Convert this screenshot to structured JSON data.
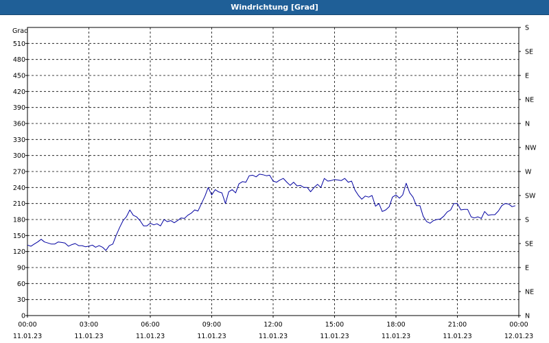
{
  "window": {
    "title": "Windrichtung [Grad]"
  },
  "chart_data": {
    "type": "line",
    "title": "Windrichtung [Grad]",
    "ylabel": "Grad",
    "ylim": [
      0,
      540
    ],
    "yticks": [
      0,
      30,
      60,
      90,
      120,
      150,
      180,
      210,
      240,
      270,
      300,
      330,
      360,
      390,
      420,
      450,
      480,
      510
    ],
    "right_axis_labels": [
      "N",
      "NE",
      "E",
      "SE",
      "S",
      "SW",
      "W",
      "NW",
      "N",
      "NE",
      "E",
      "SE",
      "S"
    ],
    "right_axis_values": [
      0,
      45,
      90,
      135,
      180,
      225,
      270,
      315,
      360,
      405,
      450,
      495,
      540
    ],
    "xlim": [
      0,
      24
    ],
    "xticks": [
      {
        "hours": 0,
        "time": "00:00",
        "date": "11.01.23"
      },
      {
        "hours": 3,
        "time": "03:00",
        "date": "11.01.23"
      },
      {
        "hours": 6,
        "time": "06:00",
        "date": "11.01.23"
      },
      {
        "hours": 9,
        "time": "09:00",
        "date": "11.01.23"
      },
      {
        "hours": 12,
        "time": "12:00",
        "date": "11.01.23"
      },
      {
        "hours": 15,
        "time": "15:00",
        "date": "11.01.23"
      },
      {
        "hours": 18,
        "time": "18:00",
        "date": "11.01.23"
      },
      {
        "hours": 21,
        "time": "21:00",
        "date": "11.01.23"
      },
      {
        "hours": 24,
        "time": "00:00",
        "date": "12.01.23"
      }
    ],
    "grid": true,
    "line_color": "#0000a0",
    "series": [
      {
        "x": [
          0,
          0.17,
          0.33,
          0.5,
          0.67,
          0.83,
          1.0,
          1.17,
          1.33,
          1.5,
          1.67,
          1.83,
          2.0,
          2.17,
          2.33,
          2.5,
          2.67,
          2.83,
          3.0,
          3.17,
          3.33,
          3.5,
          3.67,
          3.83,
          4.0,
          4.17,
          4.33,
          4.5,
          4.67,
          4.83,
          5.0,
          5.17,
          5.33,
          5.5,
          5.67,
          5.83,
          6.0,
          6.17,
          6.33,
          6.5,
          6.67,
          6.83,
          7.0,
          7.17,
          7.33,
          7.5,
          7.67,
          7.83,
          8.0,
          8.17,
          8.33,
          8.5,
          8.67,
          8.83,
          9.0,
          9.17,
          9.33,
          9.5,
          9.67,
          9.83,
          10.0,
          10.17,
          10.33,
          10.5,
          10.67,
          10.83,
          11.0,
          11.17,
          11.33,
          11.5,
          11.67,
          11.83,
          12.0,
          12.17,
          12.33,
          12.5,
          12.67,
          12.83,
          13.0,
          13.17,
          13.33,
          13.5,
          13.67,
          13.83,
          14.0,
          14.17,
          14.33,
          14.5,
          14.67,
          14.83,
          15.0,
          15.17,
          15.33,
          15.5,
          15.67,
          15.83,
          16.0,
          16.17,
          16.33,
          16.5,
          16.67,
          16.83,
          17.0,
          17.17,
          17.33,
          17.5,
          17.67,
          17.83,
          18.0,
          18.17,
          18.33,
          18.5,
          18.67,
          18.83,
          19.0,
          19.17,
          19.33,
          19.5,
          19.67,
          19.83,
          20.0,
          20.17,
          20.33,
          20.5,
          20.67,
          20.83,
          21.0,
          21.17,
          21.33,
          21.5,
          21.67,
          21.83,
          22.0,
          22.17,
          22.33,
          22.5,
          22.67,
          22.83,
          23.0,
          23.17,
          23.33,
          23.5,
          23.67,
          23.83
        ],
        "y": [
          132,
          130,
          134,
          138,
          143,
          138,
          136,
          134,
          134,
          138,
          137,
          136,
          130,
          133,
          135,
          131,
          131,
          129,
          130,
          132,
          128,
          131,
          128,
          122,
          131,
          134,
          150,
          165,
          178,
          185,
          198,
          188,
          185,
          178,
          168,
          168,
          173,
          170,
          172,
          168,
          180,
          176,
          178,
          174,
          178,
          183,
          182,
          188,
          192,
          198,
          196,
          210,
          224,
          240,
          226,
          236,
          232,
          230,
          210,
          232,
          236,
          230,
          247,
          251,
          250,
          262,
          263,
          260,
          265,
          264,
          262,
          263,
          252,
          250,
          254,
          257,
          250,
          244,
          250,
          243,
          244,
          240,
          240,
          232,
          240,
          246,
          240,
          257,
          252,
          253,
          255,
          254,
          253,
          257,
          250,
          252,
          235,
          225,
          218,
          224,
          222,
          225,
          205,
          210,
          195,
          198,
          204,
          222,
          226,
          220,
          226,
          248,
          230,
          222,
          206,
          206,
          186,
          176,
          173,
          178,
          180,
          181,
          186,
          194,
          198,
          210,
          210,
          198,
          199,
          199,
          185,
          183,
          185,
          182,
          195,
          188,
          189,
          189,
          196,
          206,
          210,
          209,
          204,
          206
        ]
      }
    ]
  }
}
